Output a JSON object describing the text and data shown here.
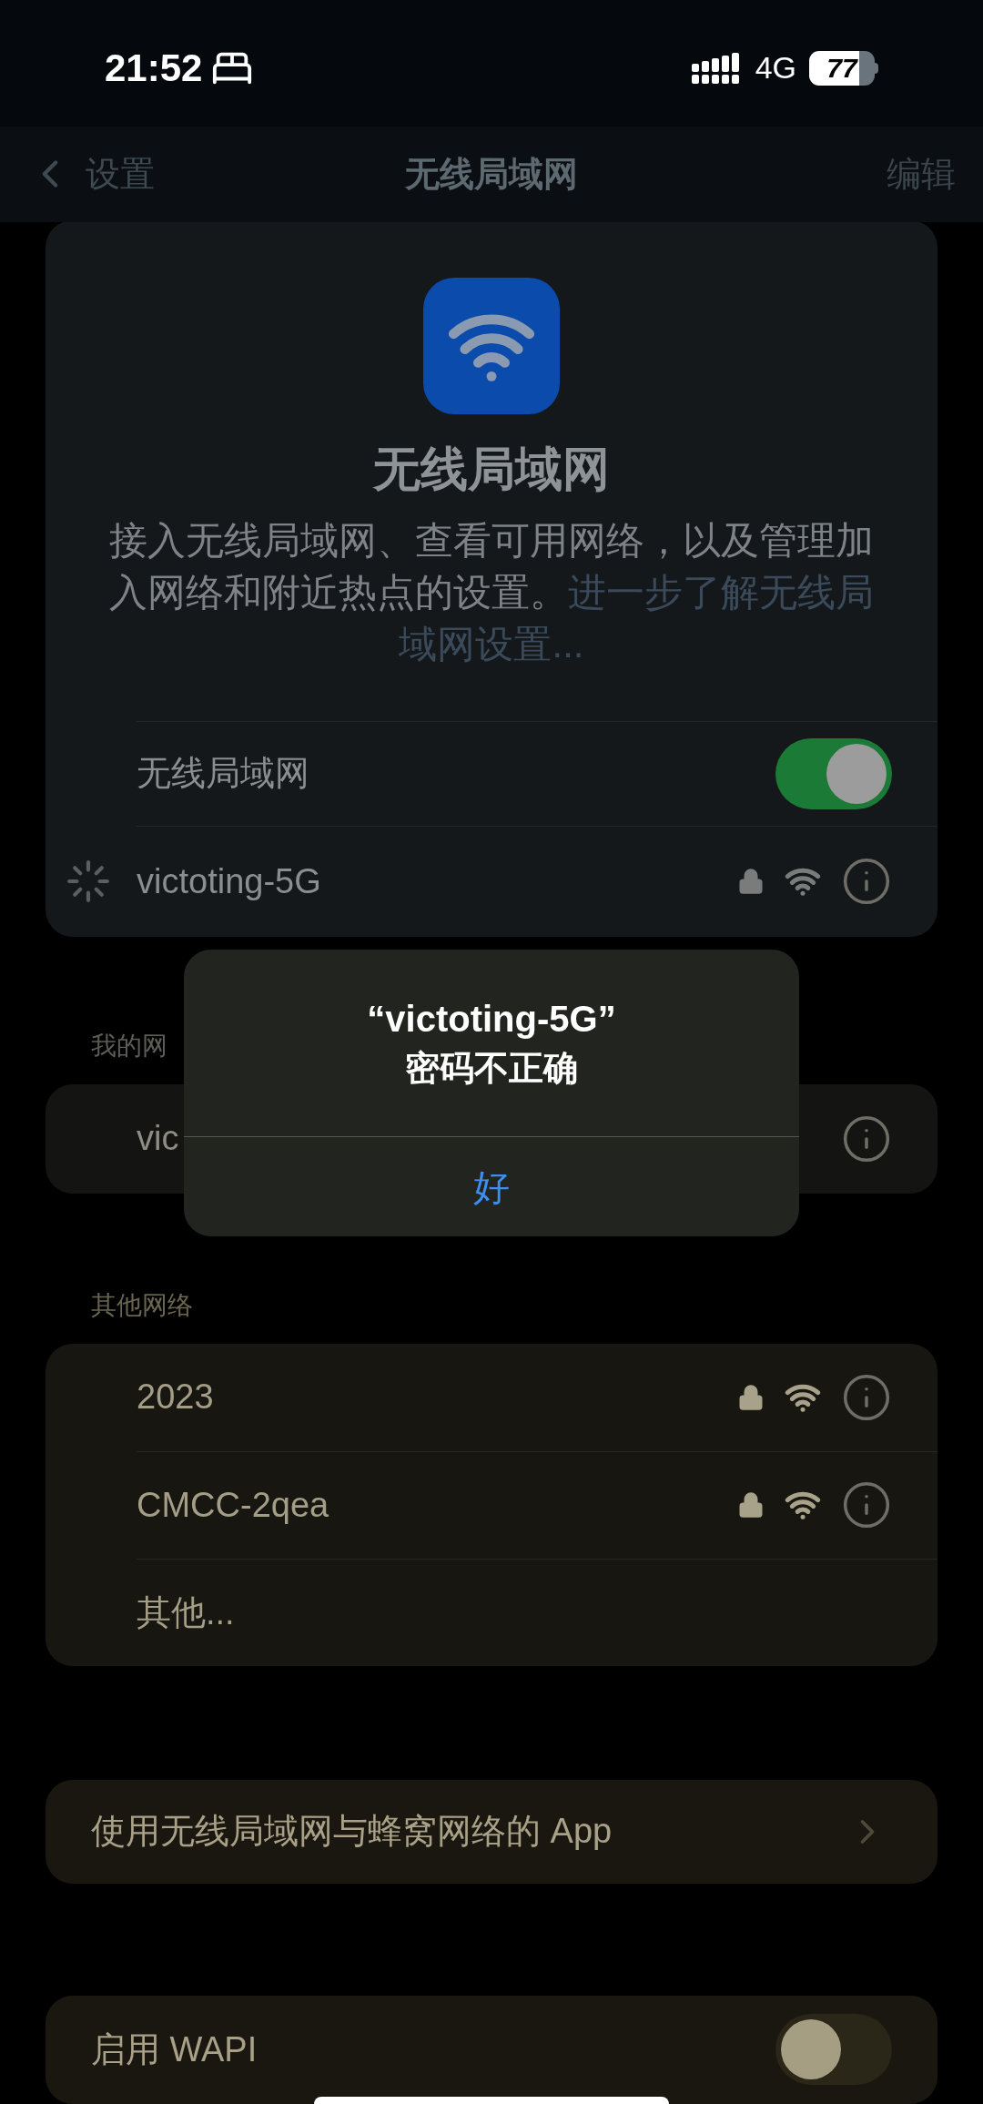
{
  "status_bar": {
    "time": "21:52",
    "network": "4G",
    "battery": "77"
  },
  "nav": {
    "back": "设置",
    "title": "无线局域网",
    "action": "编辑"
  },
  "header": {
    "title": "无线局域网",
    "description": "接入无线局域网、查看可用网络，以及管理加入网络和附近热点的设置。",
    "learn_more": [
      "进一步了解无线局",
      "域网设置..."
    ]
  },
  "wifi_toggle": {
    "label": "无线局域网",
    "on": true
  },
  "current_network": {
    "name": "victoting-5G",
    "connecting": true,
    "locked": true
  },
  "my_networks": {
    "header": "我的网",
    "rows": [
      {
        "name": "vic"
      }
    ]
  },
  "other_networks": {
    "header": "其他网络",
    "rows": [
      {
        "kind": "network",
        "name": "2023",
        "locked": true
      },
      {
        "kind": "network",
        "name": "CMCC-2qea",
        "locked": true
      },
      {
        "kind": "other",
        "name": "其他..."
      }
    ]
  },
  "apps_row": {
    "label": "使用无线局域网与蜂窝网络的 App"
  },
  "wapi_toggle": {
    "label": "启用 WAPI",
    "on": false
  },
  "alert": {
    "title": "“victoting-5G”",
    "message": "密码不正确",
    "button": "好"
  }
}
